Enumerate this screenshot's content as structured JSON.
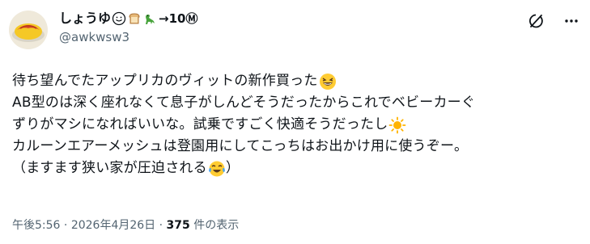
{
  "author": {
    "display_name_text": "しょうゆ",
    "display_name_suffix": "→10Ⓜ",
    "handle": "@awkwsw3",
    "avatar_icon": "omurice-avatar-icon",
    "name_emojis": [
      "smile-face-icon",
      "bread-icon",
      "dinosaur-icon"
    ]
  },
  "actions": {
    "grok_icon": "slash-circle-icon",
    "more_icon": "more-dots-icon"
  },
  "post": {
    "lines": [
      "待ち望んでたアップリカのヴィットの新作買った",
      "AB型のは深く座れなくて息子がしんどそうだったからこれでベビーカーぐ",
      "ずりがマシになればいいな。試乗ですごく快適そうだったし",
      "カルーンエアーメッシュは登園用にしてこっちはお出かけ用に使うぞー。",
      "（ますます狭い家が圧迫される",
      "）"
    ],
    "emojis": [
      "grinning-squint-icon",
      "sun-icon",
      "tears-of-joy-icon"
    ]
  },
  "meta": {
    "time": "午後5:56",
    "separator": " · ",
    "date": "2026年4月26日",
    "views_count": "375",
    "views_label": " 件の表示"
  },
  "colors": {
    "text": "#0f1419",
    "secondary": "#536471",
    "background": "#ffffff"
  }
}
